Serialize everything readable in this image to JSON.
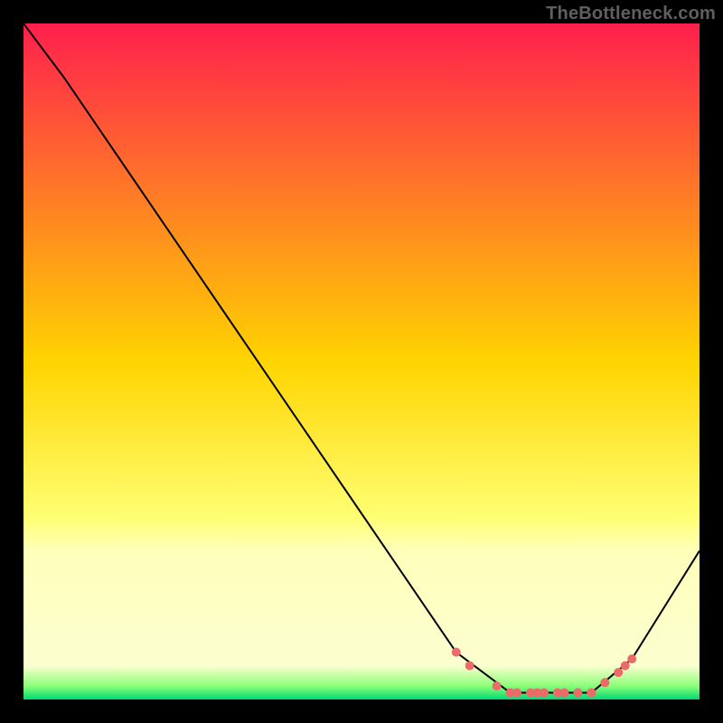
{
  "attribution": "TheBottleneck.com",
  "colors": {
    "top": "#ff1f4d",
    "mid": "#ffd400",
    "pale": "#ffff9e",
    "bottom": "#00d973",
    "curve": "#000000",
    "dot": "#ed6a6a",
    "frame": "#000000"
  },
  "chart_data": {
    "type": "line",
    "title": "",
    "xlabel": "",
    "ylabel": "",
    "xlim": [
      0,
      100
    ],
    "ylim": [
      0,
      100
    ],
    "grid": false,
    "series": [
      {
        "name": "bottleneck-curve",
        "x": [
          0,
          6,
          64,
          72,
          84,
          90,
          100
        ],
        "y": [
          100,
          92,
          7,
          1,
          1,
          6,
          22
        ],
        "color": "#000000",
        "stroke_width": 2
      }
    ],
    "markers": {
      "name": "highlight-points",
      "x": [
        64,
        66,
        70,
        72,
        73,
        75,
        76,
        77,
        79,
        80,
        82,
        84,
        86,
        88,
        89,
        90
      ],
      "y": [
        7,
        5,
        2,
        1,
        1,
        1,
        1,
        1,
        1,
        1,
        1,
        1,
        2.5,
        4,
        5,
        6
      ],
      "color": "#ed6a6a",
      "radius": 5
    },
    "background": {
      "type": "vertical-gradient",
      "stops": [
        {
          "offset": 0,
          "color": "#ff1f4d"
        },
        {
          "offset": 50,
          "color": "#ffd400"
        },
        {
          "offset": 73,
          "color": "#ffff73"
        },
        {
          "offset": 78,
          "color": "#ffffba"
        },
        {
          "offset": 95,
          "color": "#fbffcf"
        },
        {
          "offset": 98,
          "color": "#8cff78"
        },
        {
          "offset": 100,
          "color": "#00d973"
        }
      ]
    }
  }
}
